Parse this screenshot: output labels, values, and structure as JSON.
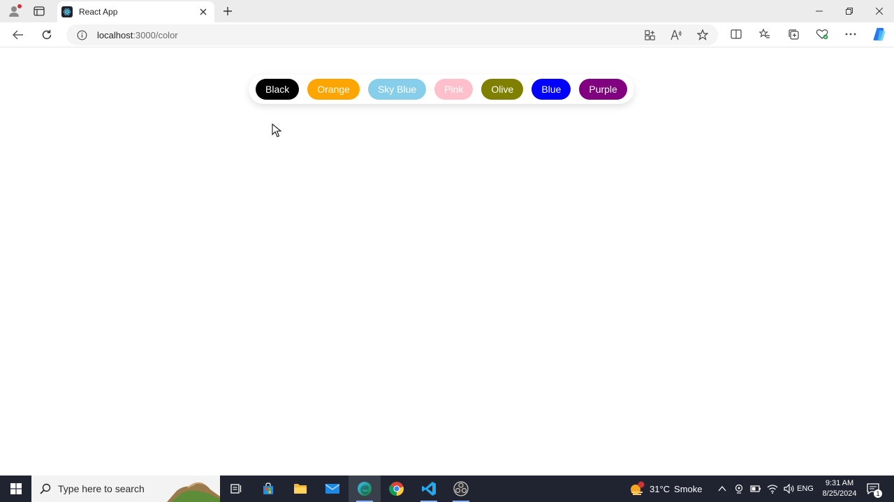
{
  "browser": {
    "tab_title": "React App",
    "url_host": "localhost",
    "url_path": ":3000/color"
  },
  "icons": {
    "profile": "profile-icon",
    "tab_actions": "tab-actions-icon",
    "favicon": "react-icon",
    "close_tab": "close-icon",
    "new_tab": "plus-icon",
    "minimize": "minimize-icon",
    "restore": "restore-icon",
    "close_window": "close-icon",
    "back": "back-arrow-icon",
    "refresh": "refresh-icon",
    "site_info": "info-icon",
    "app_available": "app-grid-icon",
    "read_aloud": "read-aloud-icon",
    "favorite": "star-icon",
    "split_screen": "split-screen-icon",
    "favorites": "favorites-icon",
    "collections": "collections-icon",
    "browser_essentials": "heart-pulse-icon",
    "more": "more-icon",
    "copilot": "copilot-icon"
  },
  "color_buttons": [
    {
      "label": "Black",
      "color": "#000000"
    },
    {
      "label": "Orange",
      "color": "#ffa500"
    },
    {
      "label": "Sky Blue",
      "color": "#87ceeb"
    },
    {
      "label": "Pink",
      "color": "#ffc0cb"
    },
    {
      "label": "Olive",
      "color": "#808000"
    },
    {
      "label": "Blue",
      "color": "#0000ff"
    },
    {
      "label": "Purple",
      "color": "#800080"
    }
  ],
  "taskbar": {
    "search_placeholder": "Type here to search",
    "weather_temp": "31°C",
    "weather_desc": "Smoke",
    "weather_alert": "1",
    "language": "ENG",
    "time": "9:31 AM",
    "date": "8/25/2024",
    "notification_count": "1"
  }
}
